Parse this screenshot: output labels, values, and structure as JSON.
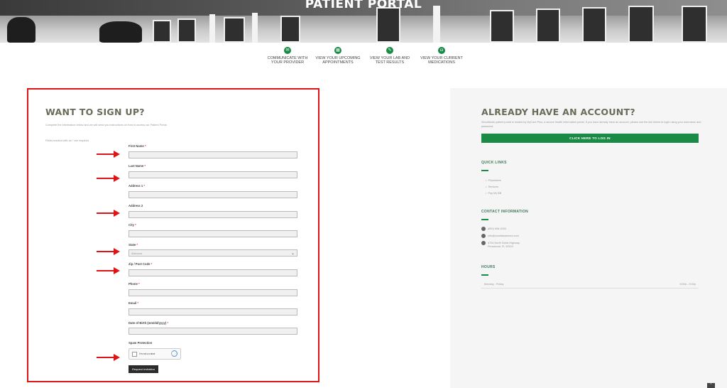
{
  "hero": {
    "title": "PATIENT PORTAL"
  },
  "features": [
    {
      "icon": "chat-icon",
      "label": "COMMUNICATE WITH YOUR PROVIDER"
    },
    {
      "icon": "calendar-icon",
      "label": "VIEW YOUR UPCOMING APPOINTMENTS"
    },
    {
      "icon": "flask-icon",
      "label": "VIEW YOUR LAB AND TEST RESULTS"
    },
    {
      "icon": "medication-icon",
      "label": "VIEW YOUR CURRENT MEDICATIONS"
    }
  ],
  "signup": {
    "heading": "WANT TO SIGN UP?",
    "intro": "Complete the information below and we will send you instructions on how to access our Patient Portal.",
    "required_note": "Fields marked with an * are required",
    "fields": [
      {
        "label": "First Name",
        "required": "*"
      },
      {
        "label": "Last Name",
        "required": "*"
      },
      {
        "label": "Address 1",
        "required": "*"
      },
      {
        "label": "Address 2",
        "required": ""
      },
      {
        "label": "City",
        "required": "*"
      },
      {
        "label": "State",
        "required": "*",
        "value": "Alabama"
      },
      {
        "label": "Zip / Post Code",
        "required": "*"
      },
      {
        "label": "Phone",
        "required": "*"
      },
      {
        "label": "Email",
        "required": "*"
      },
      {
        "label": "Date of Birth (mm/dd/yyyy)",
        "required": "*"
      }
    ],
    "spam_label": "Spam Protection",
    "captcha_text": "I'm not a robot",
    "submit_label": "Request Invitation"
  },
  "account": {
    "heading": "ALREADY HAVE AN ACCOUNT?",
    "description": "Woodlands patient portal is hosted by MyCare Plus, a secure health information portal. If you have already have an account, please use the link below to login using your username and password.",
    "login_label": "CLICK HERE TO LOG IN",
    "quick_links_heading": "QUICK LINKS",
    "quick_links": [
      "Physicians",
      "Services",
      "Pay My Bill"
    ],
    "contact_heading": "CONTACT INFORMATION",
    "phone": "(850) 696-4000",
    "email": "info@woodlandsmed.com",
    "address_line1": "4704 North Davis Highway",
    "address_line2": "Pensacola, FL 32503",
    "hours_heading": "HOURS",
    "hours_day": "Monday - Friday",
    "hours_time": "8:00a - 5:00p"
  },
  "colors": {
    "accent": "#1a8a47",
    "highlight": "#e01414",
    "heading": "#6b6b5a"
  }
}
